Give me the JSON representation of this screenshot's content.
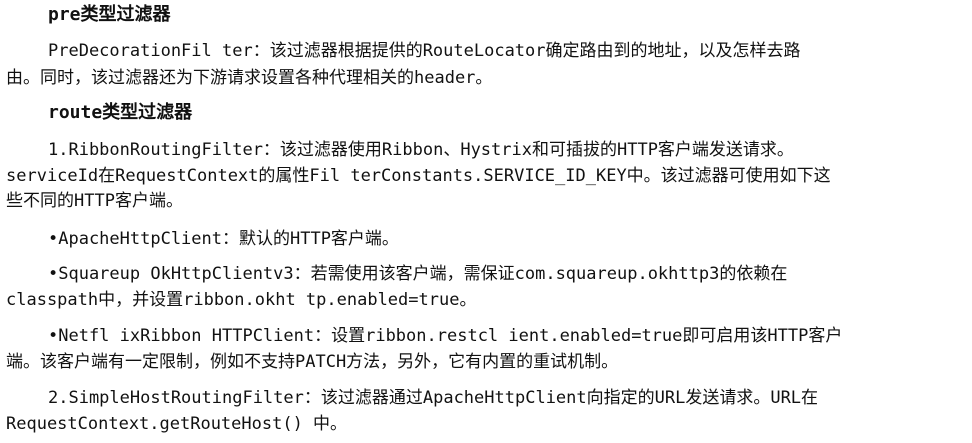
{
  "sections": [
    {
      "heading": "pre类型过滤器",
      "paragraphs": [
        {
          "lines": [
            "PreDecorationFil ter：该过滤器根据提供的RouteLocator确定路由到的地址，以及怎样去路",
            "由。同时，该过滤器还为下游请求设置各种代理相关的header。"
          ]
        }
      ]
    },
    {
      "heading": "route类型过滤器",
      "paragraphs": [
        {
          "lines": [
            "1.RibbonRoutingFilter：该过滤器使用Ribbon、Hystrix和可插拔的HTTP客户端发送请求。",
            "serviceId在RequestContext的属性Fil terConstants.SERVICE_ID_KEY中。该过滤器可使用如下这",
            "些不同的HTTP客户端。"
          ]
        },
        {
          "lines": [
            "•ApacheHttpClient：默认的HTTP客户端。"
          ]
        },
        {
          "lines": [
            "•Squareup OkHttpClientv3：若需使用该客户端，需保证com.squareup.okhttp3的依赖在",
            "classpath中，并设置ribbon.okht tp.enabled=true。"
          ]
        },
        {
          "lines": [
            "•Netfl ixRibbon HTTPClient：设置ribbon.restcl ient.enabled=true即可启用该HTTP客户",
            "端。该客户端有一定限制，例如不支持PATCH方法，另外，它有内置的重试机制。"
          ]
        },
        {
          "lines": [
            "2.SimpleHostRoutingFilter：该过滤器通过ApacheHttpClient向指定的URL发送请求。URL在",
            "RequestContext.getRouteHost() 中。"
          ]
        }
      ]
    }
  ]
}
